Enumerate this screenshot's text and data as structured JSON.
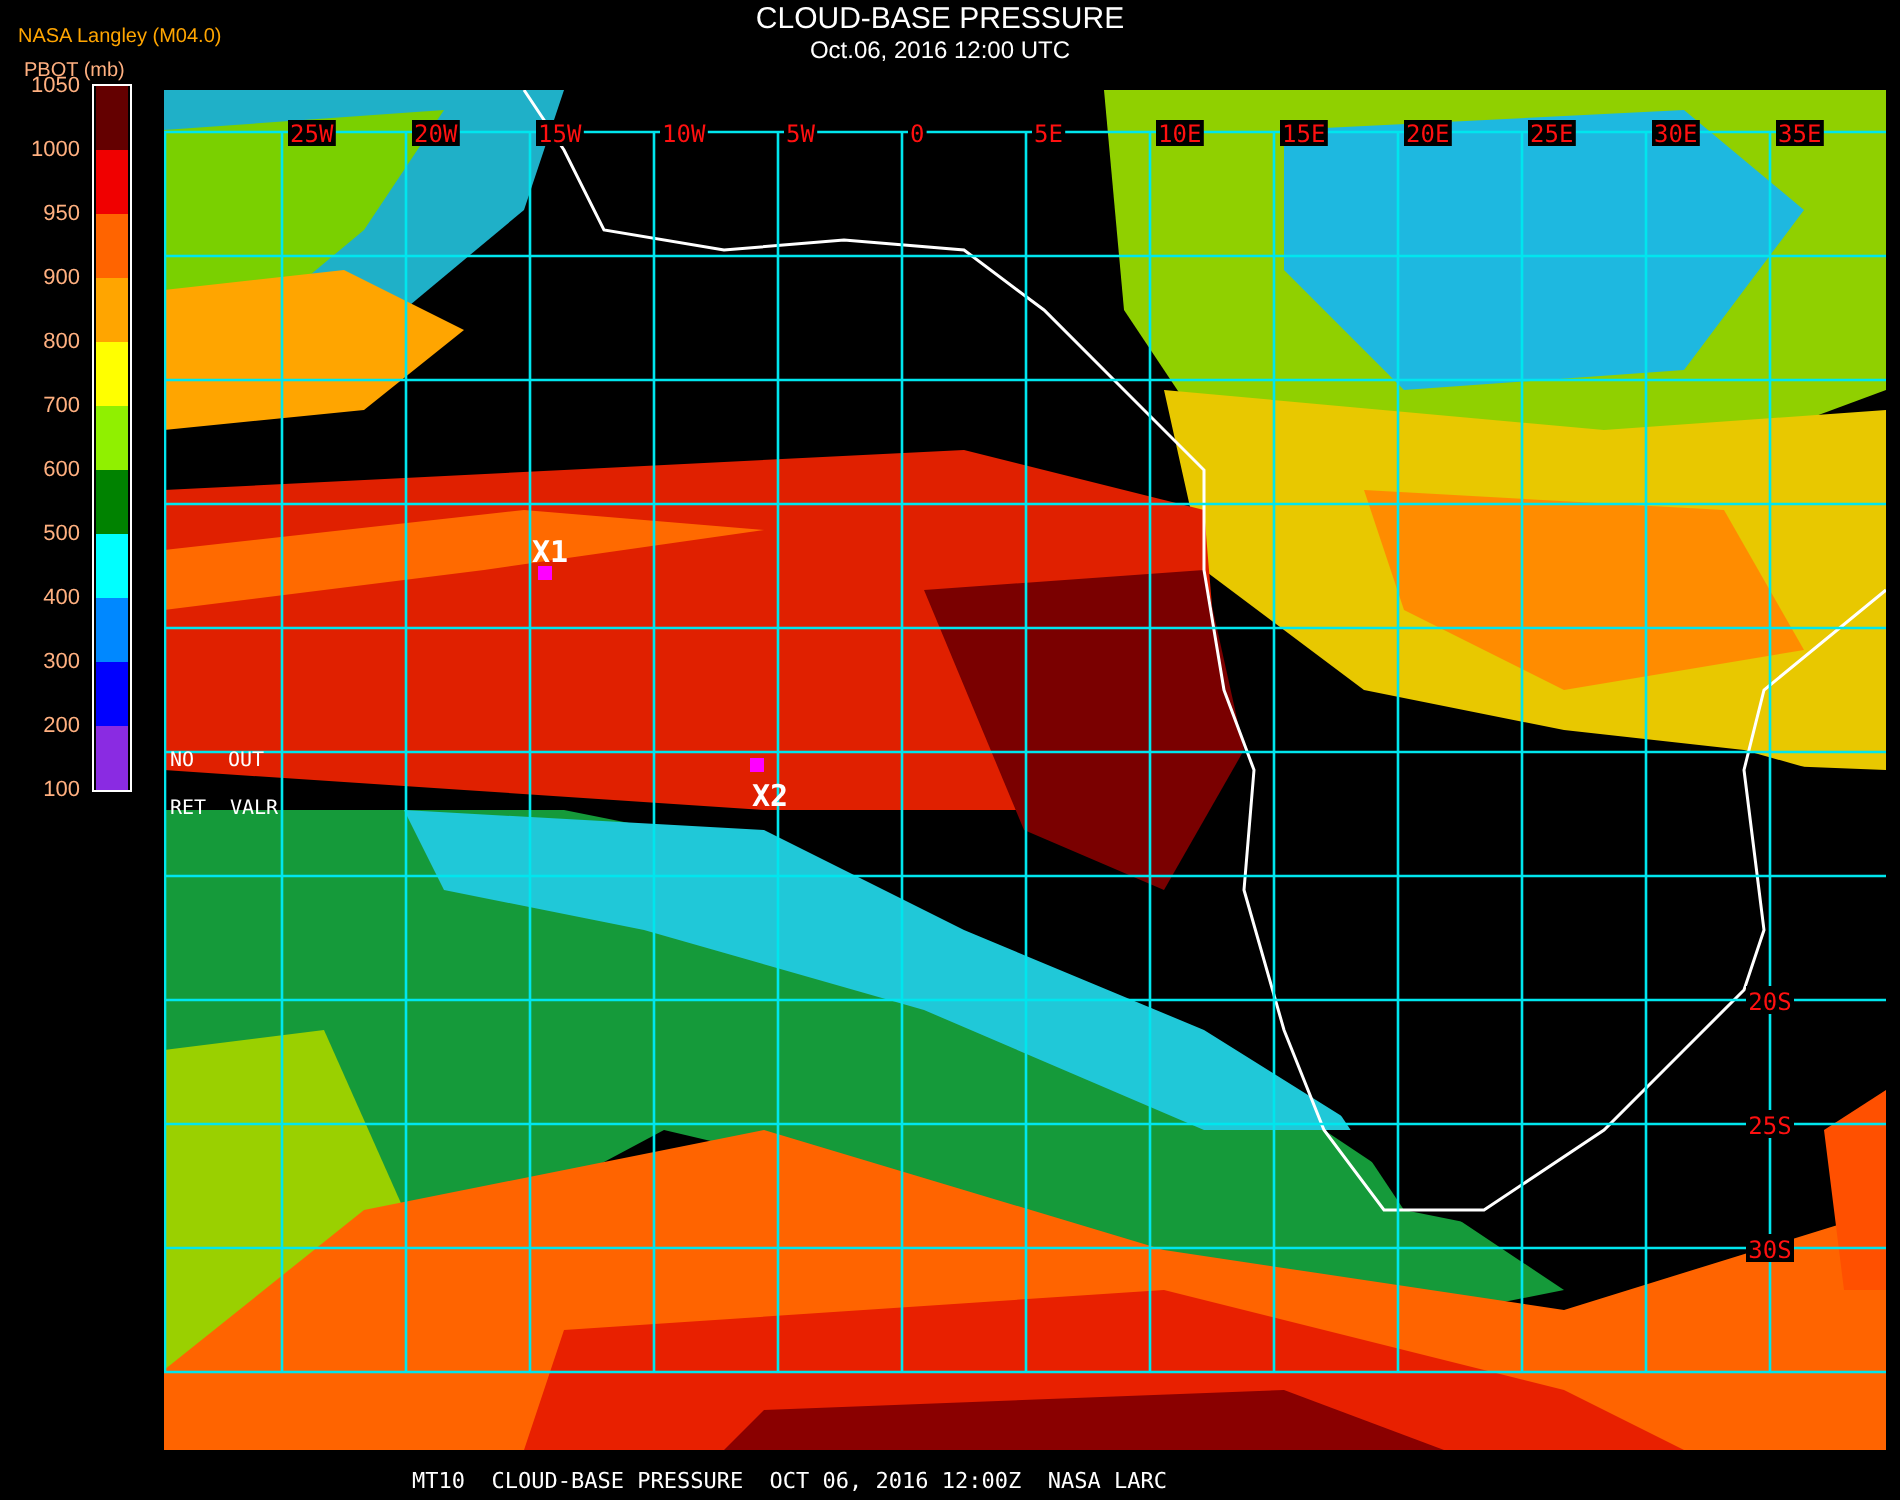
{
  "header": {
    "title": "CLOUD-BASE PRESSURE",
    "subtitle": "Oct.06, 2016 12:00 UTC"
  },
  "legend": {
    "source": "NASA Langley (M04.0)",
    "unit_label": "PBOT (mb)",
    "ticks": [
      "1050",
      "1000",
      "950",
      "900",
      "800",
      "700",
      "600",
      "500",
      "400",
      "300",
      "200",
      "100"
    ],
    "bands": [
      {
        "color": "#640000"
      },
      {
        "color": "#f00000"
      },
      {
        "color": "#ff6400"
      },
      {
        "color": "#ffa500"
      },
      {
        "color": "#ffff00"
      },
      {
        "color": "#90f000"
      },
      {
        "color": "#008200"
      },
      {
        "color": "#00ffff"
      },
      {
        "color": "#0088ff"
      },
      {
        "color": "#0000ff"
      },
      {
        "color": "#8a2be2"
      }
    ]
  },
  "map": {
    "longitude_labels": [
      "25W",
      "20W",
      "15W",
      "10W",
      "5W",
      "0",
      "5E",
      "10E",
      "15E",
      "20E",
      "25E",
      "30E",
      "35E"
    ],
    "latitude_labels": [
      "20S",
      "25S",
      "30S"
    ],
    "markers": [
      {
        "label": "X1"
      },
      {
        "label": "X2"
      }
    ],
    "key_texts": [
      "NO",
      "OUT",
      "RET",
      "VALR"
    ]
  },
  "footer": {
    "caption": "MT10  CLOUD-BASE PRESSURE  OCT 06, 2016 12:00Z  NASA LARC"
  }
}
